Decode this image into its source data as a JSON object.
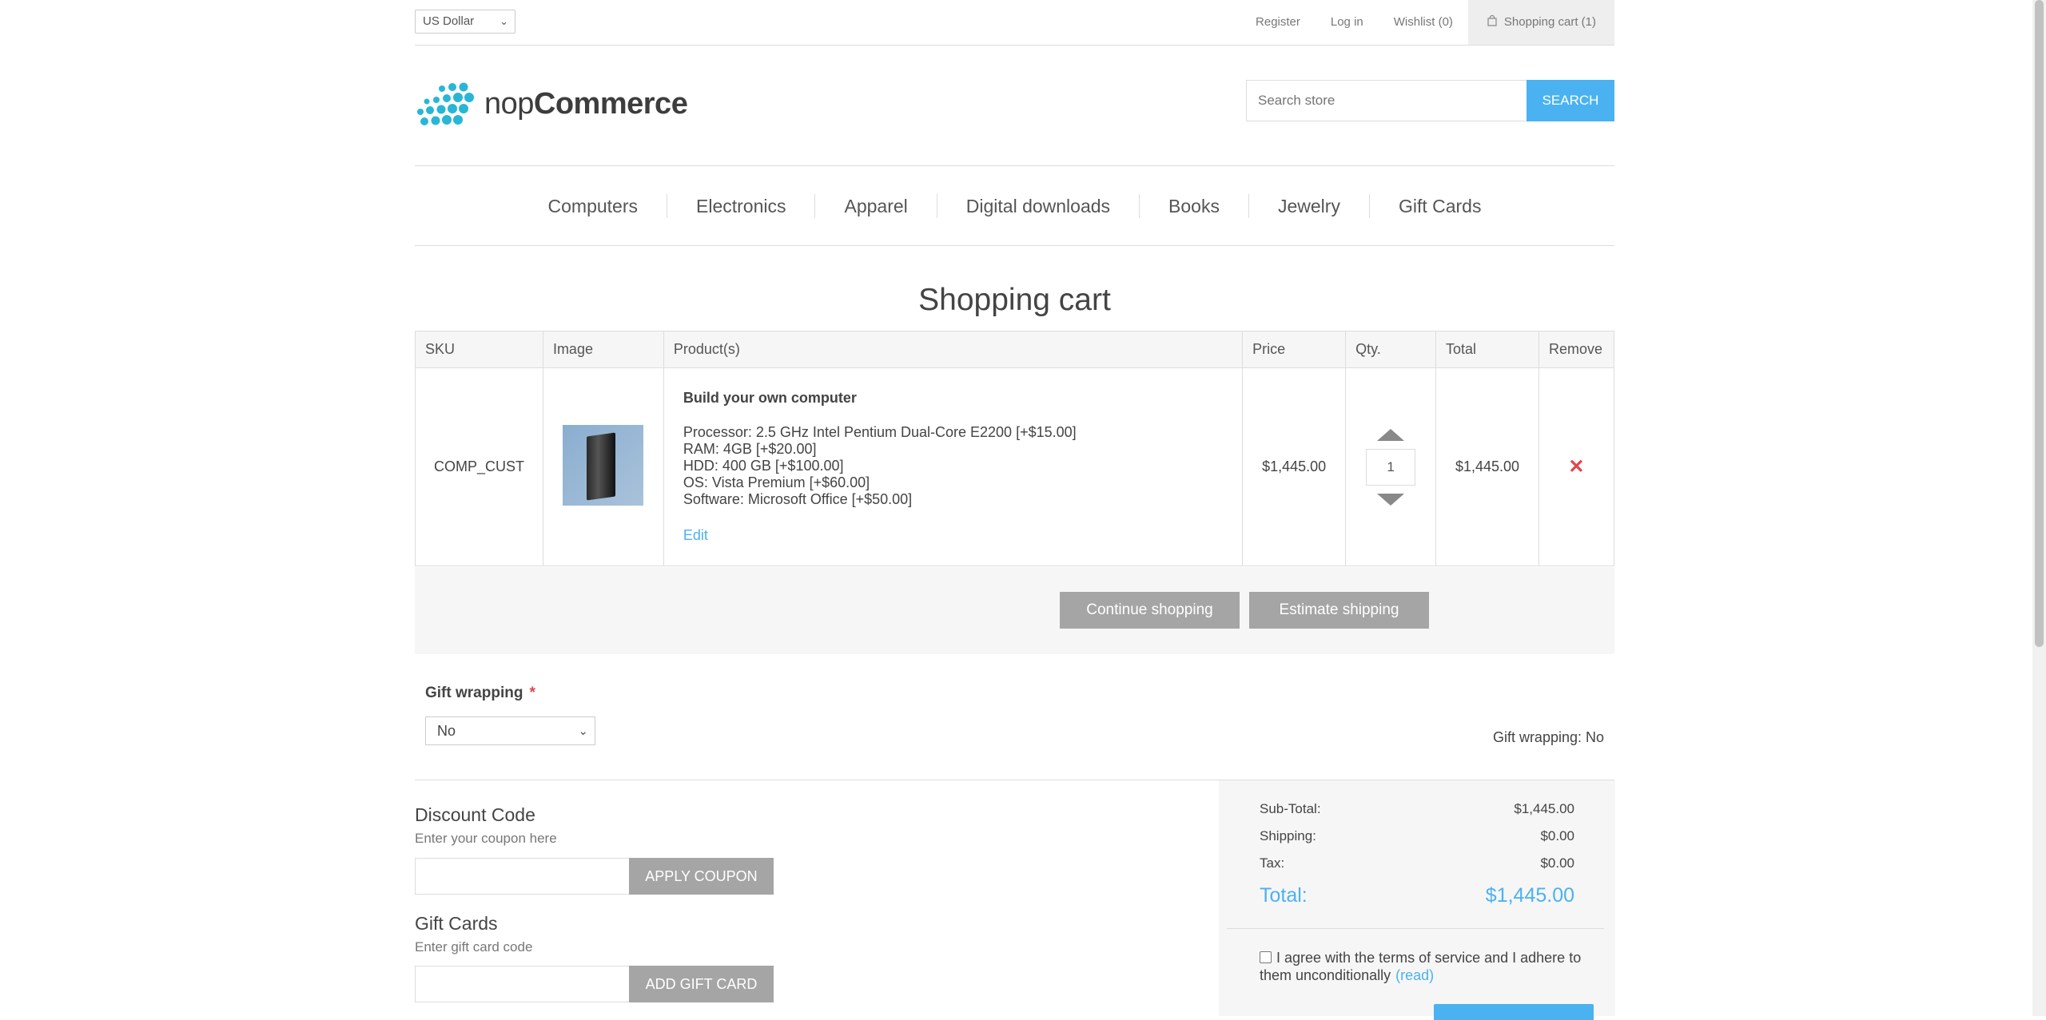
{
  "header": {
    "currency": "US Dollar",
    "links": {
      "register": "Register",
      "login": "Log in",
      "wishlist": "Wishlist (0)",
      "cart": "Shopping cart (1)"
    }
  },
  "logo": {
    "prefix": "nop",
    "suffix": "Commerce"
  },
  "search": {
    "placeholder": "Search store",
    "button": "Search"
  },
  "nav": {
    "items": [
      "Computers",
      "Electronics",
      "Apparel",
      "Digital downloads",
      "Books",
      "Jewelry",
      "Gift Cards"
    ]
  },
  "page": {
    "title": "Shopping cart"
  },
  "cart": {
    "headers": {
      "sku": "SKU",
      "image": "Image",
      "product": "Product(s)",
      "price": "Price",
      "qty": "Qty.",
      "total": "Total",
      "remove": "Remove"
    },
    "items": [
      {
        "sku": "COMP_CUST",
        "name": "Build your own computer",
        "attributes": [
          "Processor: 2.5 GHz Intel Pentium Dual-Core E2200 [+$15.00]",
          "RAM: 4GB [+$20.00]",
          "HDD: 400 GB [+$100.00]",
          "OS: Vista Premium [+$60.00]",
          "Software: Microsoft Office [+$50.00]"
        ],
        "edit": "Edit",
        "price": "$1,445.00",
        "qty": "1",
        "total": "$1,445.00",
        "remove": "✕"
      }
    ],
    "buttons": {
      "continue": "Continue shopping",
      "estimate": "Estimate shipping"
    }
  },
  "gift_wrapping": {
    "label": "Gift wrapping",
    "required": "*",
    "selected": "No",
    "summary": "Gift wrapping: No"
  },
  "discount": {
    "title": "Discount Code",
    "hint": "Enter your coupon here",
    "button": "Apply coupon"
  },
  "gift_cards": {
    "title": "Gift Cards",
    "hint": "Enter gift card code",
    "button": "Add gift card"
  },
  "totals": {
    "subtotal_label": "Sub-Total:",
    "subtotal": "$1,445.00",
    "shipping_label": "Shipping:",
    "shipping": "$0.00",
    "tax_label": "Tax:",
    "tax": "$0.00",
    "total_label": "Total:",
    "total": "$1,445.00",
    "terms": "I agree with the terms of service and I adhere to them unconditionally",
    "terms_link": "(read)"
  },
  "colors": {
    "accent": "#4ab2f1",
    "remove": "#e4434b",
    "button_gray": "#a5a5a5",
    "logo_dots": "#29b6d6"
  }
}
